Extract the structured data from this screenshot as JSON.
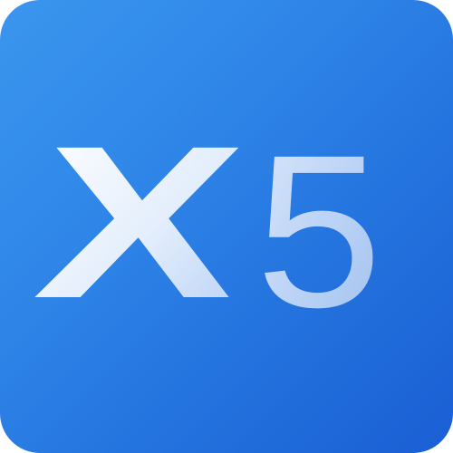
{
  "icon": {
    "glyph_letter": "X",
    "glyph_digit": "5",
    "colors": {
      "background_start": "#3a96ee",
      "background_end": "#1a5fd4",
      "glyph_highlight": "#ffffff",
      "glyph_shade": "#a9c8f2"
    }
  }
}
